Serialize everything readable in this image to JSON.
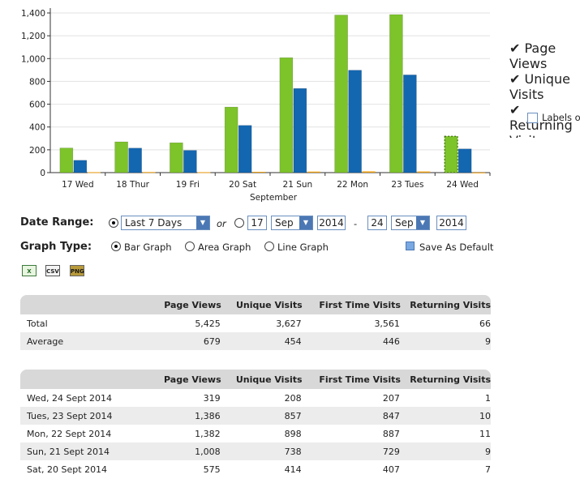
{
  "chart_data": {
    "type": "bar",
    "categories": [
      "17 Wed",
      "18 Thur",
      "19 Fri",
      "20 Sat",
      "21 Sun",
      "22 Mon",
      "23 Tues",
      "24 Wed"
    ],
    "xlabel": "September",
    "ylim": [
      0,
      1400
    ],
    "yticks": [
      "0",
      "200",
      "400",
      "600",
      "800",
      "1,000",
      "1,200",
      "1,400"
    ],
    "ytick_values": [
      0,
      200,
      400,
      600,
      800,
      1000,
      1200,
      1400
    ],
    "grid": true,
    "series": [
      {
        "name": "Page Views",
        "color": "#7dc32a",
        "values": [
          216,
          270,
          262,
          575,
          1008,
          1382,
          1386,
          319
        ]
      },
      {
        "name": "Unique Visits",
        "color": "#1366b0",
        "values": [
          108,
          215,
          195,
          414,
          738,
          898,
          857,
          208
        ]
      },
      {
        "name": "Returning Visits",
        "color": "#f0a010",
        "values": [
          4,
          5,
          4,
          7,
          9,
          11,
          10,
          1
        ]
      }
    ],
    "highlight_category_index": 7
  },
  "legend": {
    "items": [
      {
        "label": "Page Views",
        "color": "#7dc32a",
        "checked": "✔"
      },
      {
        "label": "Unique Visits",
        "color": "#1366b0",
        "checked": "✔"
      },
      {
        "label": "Returning Visits",
        "color": "#f0a010",
        "checked": "✔"
      }
    ],
    "labels_on": "Labels on"
  },
  "controls": {
    "date_range_label": "Date Range:",
    "preset_value": "Last 7 Days",
    "or": "or",
    "from_day": "17",
    "from_month": "Sep",
    "from_year": "2014",
    "dash": "-",
    "to_day": "24",
    "to_month": "Sep",
    "to_year": "2014",
    "graph_type_label": "Graph Type:",
    "bar_graph": "Bar Graph",
    "area_graph": "Area Graph",
    "line_graph": "Line Graph",
    "save_default": "Save As Default"
  },
  "export_icons": {
    "excel": "excel-icon",
    "csv": "CSV",
    "png": "PNG"
  },
  "summary_table": {
    "headers": [
      "",
      "Page Views",
      "Unique Visits",
      "First Time Visits",
      "Returning Visits"
    ],
    "rows": [
      [
        "Total",
        "5,425",
        "3,627",
        "3,561",
        "66"
      ],
      [
        "Average",
        "679",
        "454",
        "446",
        "9"
      ]
    ]
  },
  "daily_table": {
    "headers": [
      "",
      "Page Views",
      "Unique Visits",
      "First Time Visits",
      "Returning Visits"
    ],
    "rows": [
      [
        "Wed, 24 Sept 2014",
        "319",
        "208",
        "207",
        "1"
      ],
      [
        "Tues, 23 Sept 2014",
        "1,386",
        "857",
        "847",
        "10"
      ],
      [
        "Mon, 22 Sept 2014",
        "1,382",
        "898",
        "887",
        "11"
      ],
      [
        "Sun, 21 Sept 2014",
        "1,008",
        "738",
        "729",
        "9"
      ],
      [
        "Sat, 20 Sept 2014",
        "575",
        "414",
        "407",
        "7"
      ]
    ]
  }
}
